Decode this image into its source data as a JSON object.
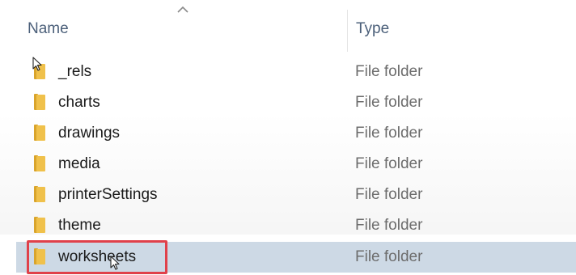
{
  "columns": {
    "name": "Name",
    "type": "Type"
  },
  "rows": [
    {
      "name": "_rels",
      "type": "File folder",
      "icon": "folder-icon"
    },
    {
      "name": "charts",
      "type": "File folder",
      "icon": "folder-icon"
    },
    {
      "name": "drawings",
      "type": "File folder",
      "icon": "folder-icon"
    },
    {
      "name": "media",
      "type": "File folder",
      "icon": "folder-icon"
    },
    {
      "name": "printerSettings",
      "type": "File folder",
      "icon": "folder-icon"
    },
    {
      "name": "theme",
      "type": "File folder",
      "icon": "folder-icon"
    },
    {
      "name": "worksheets",
      "type": "File folder",
      "icon": "folder-icon",
      "selected": true
    }
  ],
  "colors": {
    "selection": "#cdd9e5",
    "highlight_border": "#e0414a",
    "folder_main": "#f0c14b",
    "folder_dark": "#d9a42b"
  }
}
